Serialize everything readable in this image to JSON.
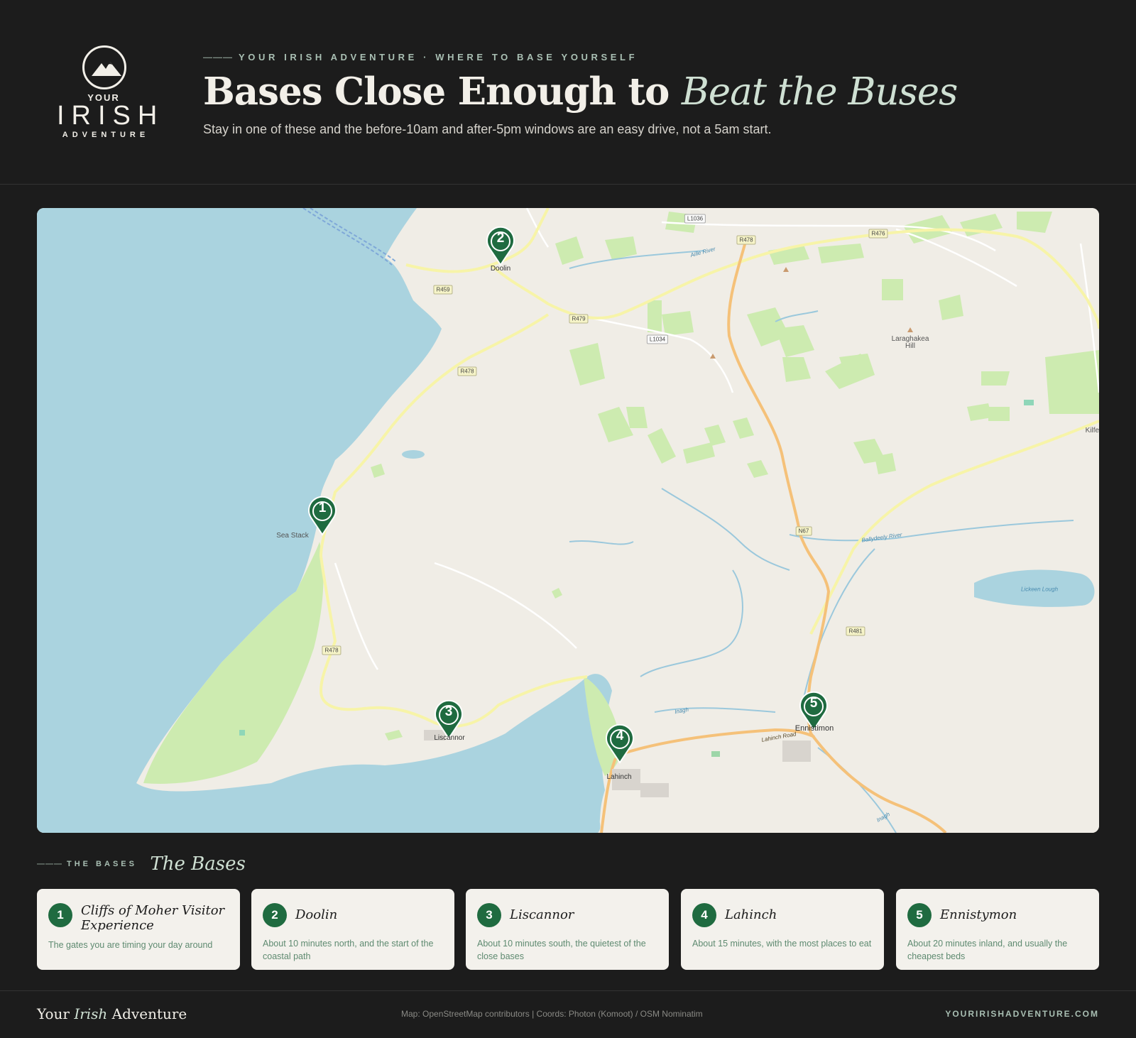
{
  "brand": {
    "logo_top": "YOUR",
    "logo_main": "IRISH",
    "logo_bottom": "ADVENTURE"
  },
  "header": {
    "eyebrow_dash": "———",
    "eyebrow": "YOUR IRISH ADVENTURE · WHERE TO BASE YOURSELF",
    "title_main": "Bases Close Enough to ",
    "title_accent": "Beat the Buses",
    "subtitle": "Stay in one of these and the before-10am and after-5pm windows are an easy drive, not a 5am start."
  },
  "map": {
    "pin_color": "#1f6b40",
    "water_color": "#aad3df",
    "land_color": "#f0ede6",
    "park_color": "#cdebb0",
    "pins": [
      {
        "number": "1",
        "label": "Sea Stack"
      },
      {
        "number": "2",
        "label": "Doolin"
      },
      {
        "number": "3",
        "label": "Liscannor"
      },
      {
        "number": "4",
        "label": "Lahinch"
      },
      {
        "number": "5",
        "label": "Ennistimon"
      }
    ],
    "places": [
      "Laraghakea Hill",
      "Kilfer"
    ],
    "roads": [
      "L1036",
      "R478",
      "R476",
      "R459",
      "R479",
      "L1034",
      "R478",
      "R478",
      "N67",
      "R481",
      "Lahinch Road"
    ],
    "water": [
      "Aille River",
      "Ballydeely River",
      "Lickeen Lough",
      "Inagh",
      "Inagh"
    ]
  },
  "bases": {
    "eyebrow_dash": "———",
    "eyebrow": "THE BASES",
    "title": "The Bases",
    "items": [
      {
        "number": "1",
        "name": "Cliffs of Moher Visitor Experience",
        "desc": "The gates you are timing your day around"
      },
      {
        "number": "2",
        "name": "Doolin",
        "desc": "About 10 minutes north, and the start of the coastal path"
      },
      {
        "number": "3",
        "name": "Liscannor",
        "desc": "About 10 minutes south, the quietest of the close bases"
      },
      {
        "number": "4",
        "name": "Lahinch",
        "desc": "About 15 minutes, with the most places to eat"
      },
      {
        "number": "5",
        "name": "Ennistymon",
        "desc": "About 20 minutes inland, and usually the cheapest beds"
      }
    ]
  },
  "footer": {
    "brand_pre": "Your ",
    "brand_accent": "Irish",
    "brand_post": " Adventure",
    "credit": "Map: OpenStreetMap contributors | Coords: Photon (Komoot) / OSM Nominatim",
    "url": "YOURIRISHADVENTURE.COM"
  },
  "colors": {
    "background": "#1c1c1c",
    "accent_green": "#1f6b40",
    "muted_green": "#a9bfb3",
    "card_bg": "#f3f1ec"
  }
}
